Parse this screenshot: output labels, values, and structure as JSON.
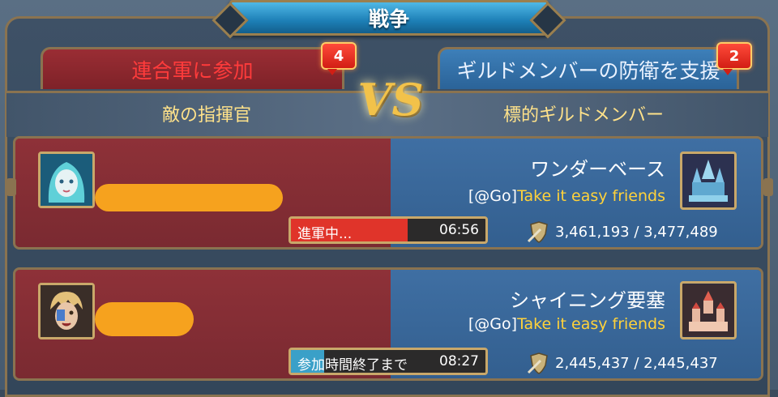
{
  "title": "戦争",
  "tabs": {
    "left": {
      "label": "連合軍に参加",
      "badge": "4"
    },
    "right": {
      "label": "ギルドメンバーの防衛を支援",
      "badge": "2"
    }
  },
  "vs": "VS",
  "headers": {
    "left": "敵の指揮官",
    "right": "標的ギルドメンバー"
  },
  "rows": [
    {
      "castle": "ワンダーベース",
      "guild_tag": "[@Go]",
      "guild_name": "Take it easy friends",
      "status": "進軍中...",
      "timer": "06:56",
      "progress": 0.6,
      "progress_color": "#e0342a",
      "power": "3,461,193 / 3,477,489"
    },
    {
      "castle": "シャイニング要塞",
      "guild_tag": "[@Go]",
      "guild_name": "Take it easy friends",
      "status": "参加時間終了まで",
      "timer": "08:27",
      "progress": 0.17,
      "progress_color": "#3aa0c8",
      "power": "2,445,437 / 2,445,437"
    }
  ]
}
